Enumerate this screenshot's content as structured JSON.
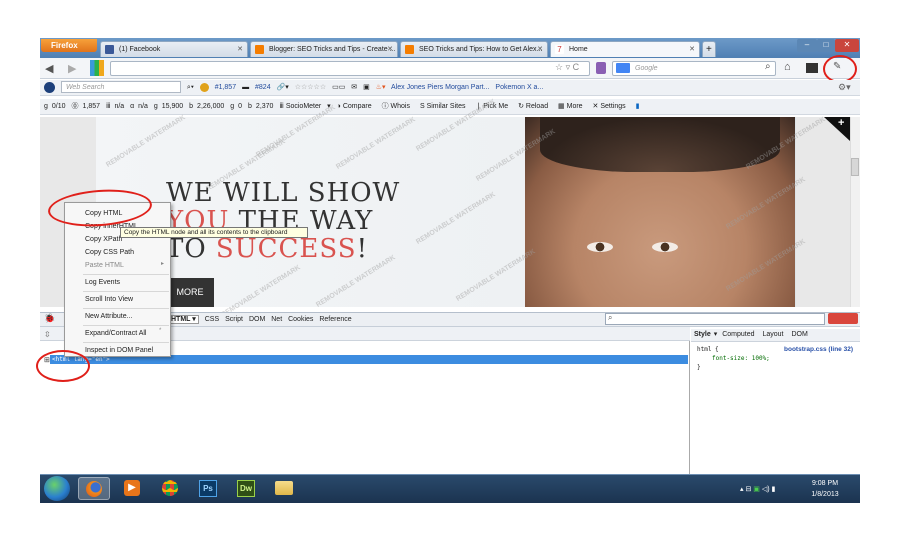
{
  "browser": {
    "firefox_label": "Firefox",
    "tabs": [
      {
        "label": "(1) Facebook",
        "color": "#3b5998"
      },
      {
        "label": "Blogger: SEO Tricks and Tips - Create ...",
        "color": "#f57d00"
      },
      {
        "label": "SEO Tricks and Tips: How to Get Alex...",
        "color": "#f57d00"
      },
      {
        "label": "Home",
        "color": "#ffffff"
      }
    ],
    "new_tab": "+",
    "search_placeholder": "Web Search",
    "google_placeholder": "Google",
    "toolbar3": {
      "rank1": "#1,857",
      "rank2": "#824",
      "news1": "Alex Jones Piers Morgan Part...",
      "news2": "Pokemon X a..."
    },
    "toolbar4": {
      "v1": "0/10",
      "v2": "1,857",
      "v3": "n/a",
      "v4": "n/a",
      "v5": "15,900",
      "v6": "2,26,000",
      "v7": "0",
      "v8": "2,370",
      "sociometer": "SocioMeter",
      "compare": "Compare",
      "whois": "Whois",
      "similar": "Similar Sites",
      "pickme": "Pick Me",
      "reload": "Reload",
      "more": "More",
      "settings": "Settings"
    }
  },
  "hero": {
    "line1": "WE WILL SHOW",
    "line2a": "YOU",
    "line2b": "THE WAY",
    "line3a": "TO ",
    "line3b": "SUCCESS",
    "line3c": "!",
    "more_button": "MORE",
    "watermark": "REMOVABLE WATERMARK"
  },
  "context_menu": {
    "items": [
      "Copy HTML",
      "Copy innerHTML",
      "Copy XPath",
      "Copy CSS Path",
      "Paste HTML",
      "Log Events",
      "Scroll Into View",
      "New Attribute...",
      "Expand/Contract All",
      "Inspect in DOM Panel"
    ],
    "tooltip": "Copy the HTML node and all its contents to the clipboard"
  },
  "firebug": {
    "tabs": [
      "HTML",
      "CSS",
      "Script",
      "DOM",
      "Net",
      "Cookies",
      "Reference"
    ],
    "html_node": "<html lang=\"en\">",
    "style_tabs": [
      "Style",
      "Computed",
      "Layout",
      "DOM"
    ],
    "style_source": "bootstrap.css (line 32)",
    "style_rule_selector": "html {",
    "style_rule_body": "font-size: 100%;",
    "style_rule_close": "}"
  },
  "taskbar": {
    "time": "9:08 PM",
    "date": "1/8/2013",
    "ps_label": "Ps",
    "dw_label": "Dw"
  }
}
